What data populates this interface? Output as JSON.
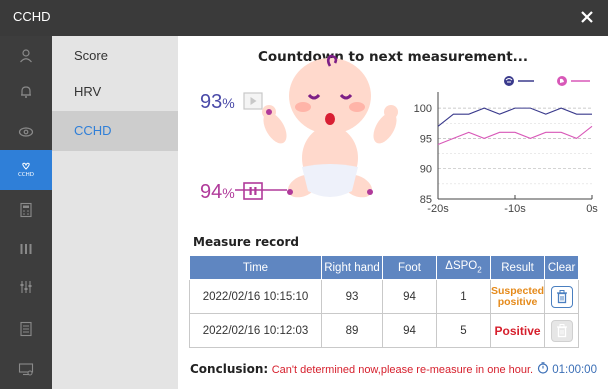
{
  "window": {
    "title": "CCHD",
    "close_glyph": "✕"
  },
  "rail": {
    "items": [
      {
        "icon": "person-icon"
      },
      {
        "icon": "bell-icon"
      },
      {
        "icon": "eye-icon"
      },
      {
        "icon": "cchd-icon",
        "label": "CCHD",
        "active": true
      },
      {
        "icon": "calculator-icon"
      },
      {
        "icon": "grid-icon"
      },
      {
        "icon": "sliders-icon"
      },
      {
        "icon": "document-icon"
      },
      {
        "icon": "monitor-icon"
      }
    ]
  },
  "submenu": {
    "items": [
      {
        "label": "Score"
      },
      {
        "label": "HRV"
      },
      {
        "label": "CCHD",
        "active": true
      }
    ]
  },
  "main": {
    "countdown": "Countdown to next measurement...",
    "spo2_right": {
      "value": "93",
      "unit": "%",
      "color": "#4a4aa8"
    },
    "spo2_foot": {
      "value": "94",
      "unit": "%",
      "color": "#b03a9a"
    }
  },
  "chart_data": {
    "type": "line",
    "x": [
      -20,
      -18,
      -16,
      -14,
      -12,
      -10,
      -8,
      -6,
      -4,
      -2,
      0
    ],
    "series": [
      {
        "color": "#3a3a8c",
        "values": [
          97,
          99,
          99,
          100,
          99,
          100,
          100,
          99,
          100,
          99,
          99
        ]
      },
      {
        "color": "#d858b8",
        "values": [
          94,
          95,
          96,
          95,
          96,
          96,
          95,
          96,
          96,
          95,
          97
        ]
      }
    ],
    "xticks": [
      "-20s",
      "-10s",
      "0s"
    ],
    "yticks": [
      "100",
      "95",
      "90",
      "85"
    ],
    "xlim": [
      -20,
      0
    ],
    "ylim": [
      85,
      102
    ],
    "grid": true,
    "legend": "top-right"
  },
  "records": {
    "title": "Measure record",
    "headers": {
      "time": "Time",
      "right_hand": "Right hand",
      "foot": "Foot",
      "delta_prefix": "ΔSPO",
      "delta_sub": "2",
      "result": "Result",
      "clear": "Clear"
    },
    "rows": [
      {
        "time": "2022/02/16 10:15:10",
        "right_hand": "93",
        "foot": "94",
        "delta": "1",
        "result_line1": "Suspected",
        "result_line2": "positive",
        "result_color": "#e58a1a"
      },
      {
        "time": "2022/02/16 10:12:03",
        "right_hand": "89",
        "foot": "94",
        "delta": "5",
        "result": "Positive",
        "result_color": "#d61f2c"
      }
    ]
  },
  "conclusion": {
    "label": "Conclusion:",
    "text": "Can't determined now,please re-measure in one hour.",
    "timer": "01:00:00",
    "timer_color": "#3b6fb6"
  }
}
